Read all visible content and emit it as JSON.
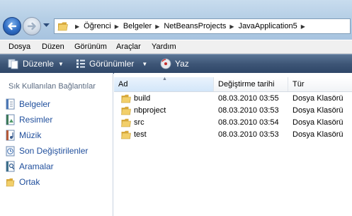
{
  "breadcrumbs": [
    "Öğrenci",
    "Belgeler",
    "NetBeansProjects",
    "JavaApplication5"
  ],
  "menu": [
    "Dosya",
    "Düzen",
    "Görünüm",
    "Araçlar",
    "Yardım"
  ],
  "toolbar": {
    "organize": "Düzenle",
    "views": "Görünümler",
    "burn": "Yaz"
  },
  "leftnav": {
    "title": "Sık Kullanılan Bağlantılar",
    "items": [
      {
        "label": "Belgeler",
        "icon": "documents-icon"
      },
      {
        "label": "Resimler",
        "icon": "pictures-icon"
      },
      {
        "label": "Müzik",
        "icon": "music-icon"
      },
      {
        "label": "Son Değiştirilenler",
        "icon": "recent-icon"
      },
      {
        "label": "Aramalar",
        "icon": "searches-icon"
      },
      {
        "label": "Ortak",
        "icon": "folder-icon"
      }
    ]
  },
  "columns": [
    "Ad",
    "Değiştirme tarihi",
    "Tür"
  ],
  "files": [
    {
      "name": "build",
      "date": "08.03.2010 03:55",
      "type": "Dosya Klasörü"
    },
    {
      "name": "nbproject",
      "date": "08.03.2010 03:53",
      "type": "Dosya Klasörü"
    },
    {
      "name": "src",
      "date": "08.03.2010 03:54",
      "type": "Dosya Klasörü"
    },
    {
      "name": "test",
      "date": "08.03.2010 03:53",
      "type": "Dosya Klasörü"
    }
  ],
  "colors": {
    "toolbar": "#3d5576",
    "link": "#1f4e9c",
    "folder": "#e8c04e"
  }
}
